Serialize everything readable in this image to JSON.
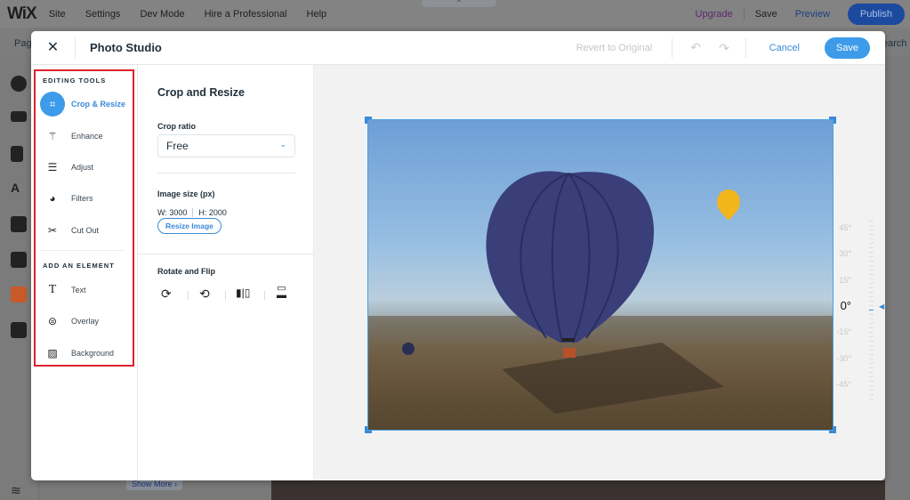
{
  "topbar": {
    "logo": "WiX",
    "menu": [
      "Site",
      "Settings",
      "Dev Mode",
      "Hire a Professional",
      "Help"
    ],
    "upgrade": "Upgrade",
    "save": "Save",
    "preview": "Preview",
    "publish": "Publish",
    "collapse": "^"
  },
  "subbar": {
    "left": "Pag",
    "right": "earch"
  },
  "background": {
    "show_more": "Show More ›"
  },
  "modal": {
    "title": "Photo Studio",
    "close": "✕",
    "revert": "Revert to Original",
    "undo": "↶",
    "redo": "↷",
    "cancel": "Cancel",
    "save": "Save",
    "help": "?"
  },
  "tools": {
    "editing_heading": "EDITING TOOLS",
    "editing": [
      {
        "label": "Crop & Resize",
        "icon": "crop-icon",
        "glyph": "⌗"
      },
      {
        "label": "Enhance",
        "icon": "magic-wand-icon",
        "glyph": "⚚"
      },
      {
        "label": "Adjust",
        "icon": "sliders-icon",
        "glyph": "☰"
      },
      {
        "label": "Filters",
        "icon": "filters-icon",
        "glyph": "◕"
      },
      {
        "label": "Cut Out",
        "icon": "scissors-icon",
        "glyph": "✂"
      }
    ],
    "element_heading": "ADD AN ELEMENT",
    "elements": [
      {
        "label": "Text",
        "icon": "text-icon",
        "glyph": "T"
      },
      {
        "label": "Overlay",
        "icon": "overlay-icon",
        "glyph": "⊜"
      },
      {
        "label": "Background",
        "icon": "background-icon",
        "glyph": "▨"
      }
    ]
  },
  "panel": {
    "title": "Crop and Resize",
    "crop_ratio_label": "Crop ratio",
    "crop_ratio": "Free",
    "image_size_label": "Image size (px)",
    "width": "W: 3000",
    "height": "H: 2000",
    "resize_button": "Resize Image",
    "rotate_label": "Rotate and Flip"
  },
  "rotation": {
    "labels": [
      "45°",
      "30°",
      "15°",
      "0°",
      "-15°",
      "-30°",
      "-45°"
    ],
    "current": "0°"
  },
  "colors": {
    "accent": "#3d9be9",
    "highlight_box": "#e0222e"
  }
}
